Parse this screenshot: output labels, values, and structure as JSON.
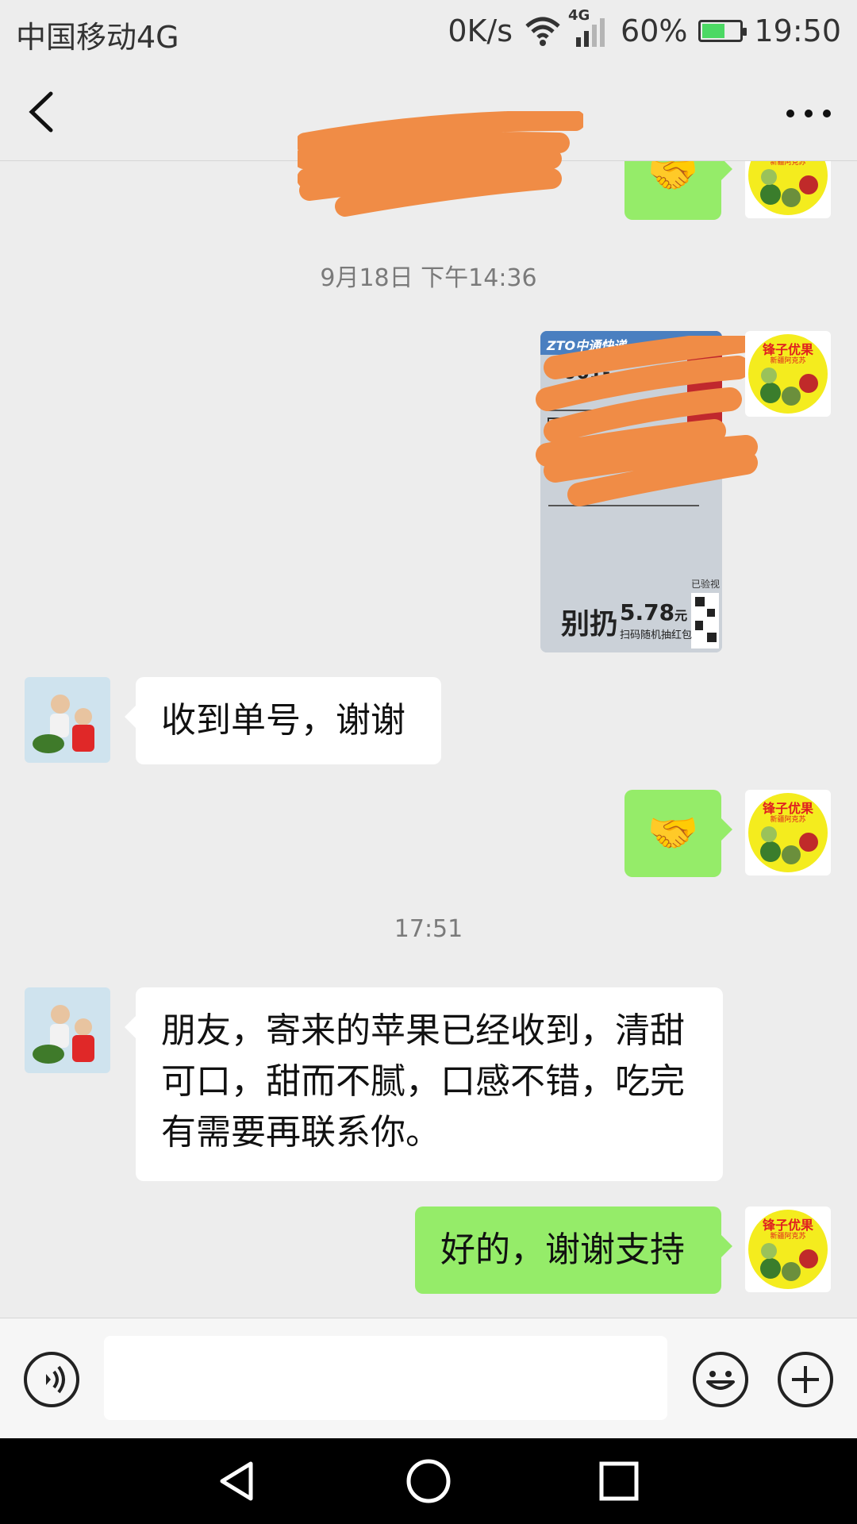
{
  "status_bar": {
    "carrier": "中国移动4G",
    "speed": "0K/s",
    "network": "4G",
    "battery": "60%",
    "battery_level": 0.6,
    "time": "19:50"
  },
  "nav": {
    "title": "",
    "back_icon": "back-chevron-icon",
    "more_icon": "more-dots-icon"
  },
  "messages": [
    {
      "type": "outgoing_emoji",
      "emoji": "🤝"
    },
    {
      "type": "timestamp",
      "text": "9月18日 下午14:36"
    },
    {
      "type": "outgoing_image",
      "photo": {
        "brand": "ZTO中通快递",
        "code": "661-",
        "promo_title": "别扔",
        "promo_price": "5.78",
        "promo_unit": "元",
        "promo_sub": "扫码随机抽红包",
        "stamp": "已验视"
      }
    },
    {
      "type": "incoming_text",
      "text": "收到单号，谢谢"
    },
    {
      "type": "outgoing_emoji",
      "emoji": "🤝"
    },
    {
      "type": "timestamp",
      "text": "17:51"
    },
    {
      "type": "incoming_text",
      "lines": [
        "朋友，寄来的苹果已经收到，清甜",
        "可口，甜而不腻，口感不错，吃完",
        "有需要再联系你。"
      ]
    },
    {
      "type": "outgoing_text",
      "text": "好的，谢谢支持"
    }
  ],
  "my_avatar": {
    "title": "锋子优果",
    "subtitle": "新疆阿克苏",
    "colors": {
      "bg": "#f4ec1e",
      "text": "#e02020"
    }
  },
  "input_bar": {
    "voice_icon": "voice-icon",
    "emoji_icon": "emoji-icon",
    "plus_icon": "plus-icon",
    "draft": ""
  },
  "system_nav": {
    "back_icon": "triangle-back-icon",
    "home_icon": "circle-home-icon",
    "recents_icon": "square-recents-icon"
  }
}
